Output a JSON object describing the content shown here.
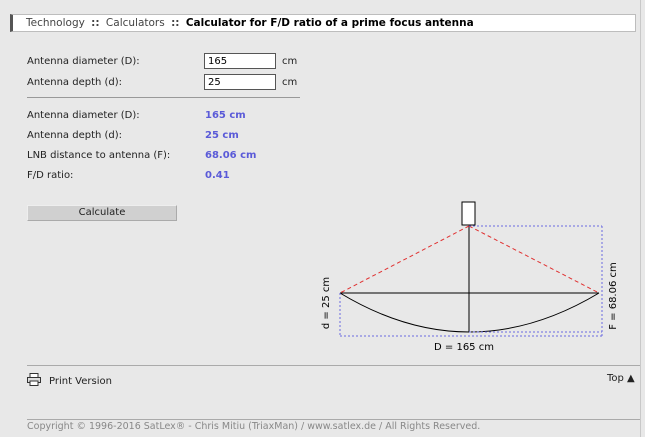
{
  "breadcrumb": {
    "item1": "Technology",
    "item2": "Calculators",
    "current": "Calculator for F/D ratio of a prime focus antenna",
    "separator": "::"
  },
  "form": {
    "diameter_label": "Antenna diameter (D):",
    "diameter_value": "165",
    "diameter_unit": "cm",
    "depth_label": "Antenna depth (d):",
    "depth_value": "25",
    "depth_unit": "cm"
  },
  "results": {
    "diameter_label": "Antenna diameter (D):",
    "diameter_value": "165 cm",
    "depth_label": "Antenna depth (d):",
    "depth_value": "25 cm",
    "lnb_label": "LNB distance to antenna (F):",
    "lnb_value": "68.06 cm",
    "ratio_label": "F/D ratio:",
    "ratio_value": "0.41"
  },
  "button": {
    "calculate": "Calculate"
  },
  "diagram": {
    "depth_text": "d = 25 cm",
    "focal_text": "F = 68.06 cm",
    "diameter_text": "D = 165 cm"
  },
  "footer": {
    "print": "Print Version",
    "top": "Top ▲",
    "copyright": "Copyright © 1996-2016 SatLex® - Chris Mitiu (TriaxMan) / www.satlex.de / All Rights Reserved."
  },
  "colors": {
    "value_color": "#5a5ad8",
    "ray_color": "#e03030",
    "dim_color": "#6a6ae0"
  }
}
